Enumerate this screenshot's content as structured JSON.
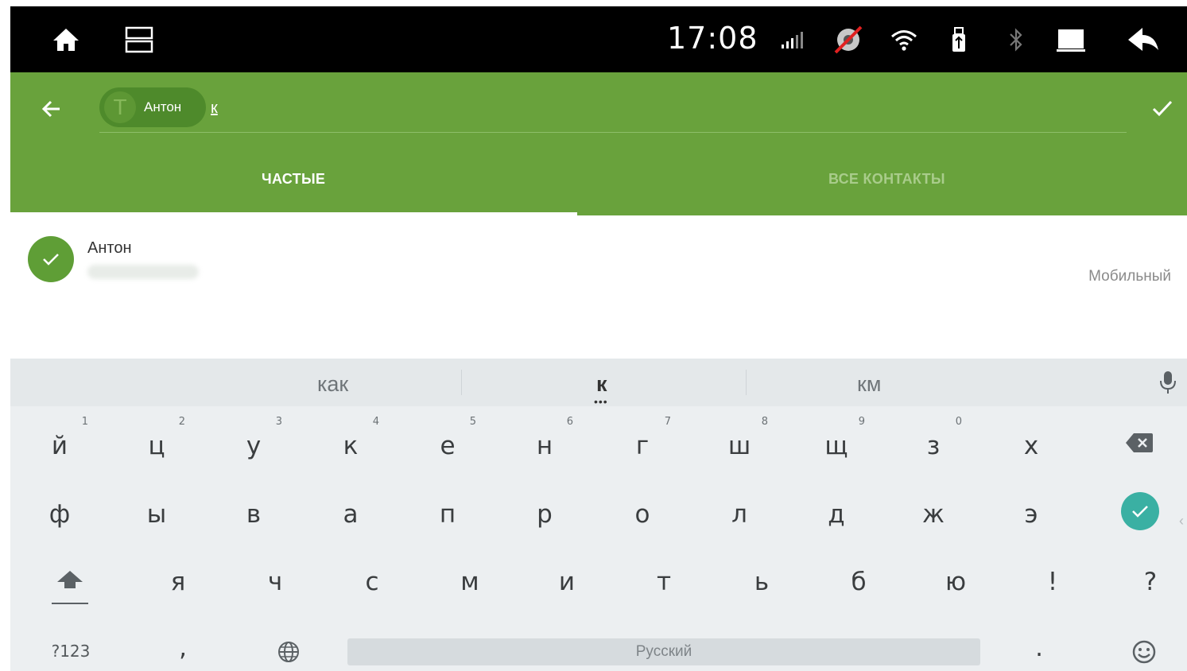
{
  "status_bar": {
    "time": "17:08",
    "icons": [
      "home-icon",
      "recent-apps-icon",
      "signal-icon",
      "gps-off-icon",
      "wifi-icon",
      "usb-icon",
      "bluetooth-icon",
      "screen-icon",
      "back-icon"
    ]
  },
  "header": {
    "chip": {
      "avatar_letter": "T",
      "name": "Антон"
    },
    "query": "к",
    "tabs": [
      {
        "label": "ЧАСТЫЕ",
        "active": true
      },
      {
        "label": "ВСЕ КОНТАКТЫ",
        "active": false
      }
    ],
    "colors": {
      "background": "#69a23c",
      "chip": "#4e8a2b"
    }
  },
  "contact": {
    "name": "Антон",
    "type": "Мобильный",
    "selected": true
  },
  "keyboard": {
    "suggestions": [
      "как",
      "к",
      "км"
    ],
    "row1": [
      {
        "label": "й",
        "hint": "1"
      },
      {
        "label": "ц",
        "hint": "2"
      },
      {
        "label": "у",
        "hint": "3"
      },
      {
        "label": "к",
        "hint": "4"
      },
      {
        "label": "е",
        "hint": "5"
      },
      {
        "label": "н",
        "hint": "6"
      },
      {
        "label": "г",
        "hint": "7"
      },
      {
        "label": "ш",
        "hint": "8"
      },
      {
        "label": "щ",
        "hint": "9"
      },
      {
        "label": "з",
        "hint": "0"
      },
      {
        "label": "х",
        "hint": ""
      }
    ],
    "row2": [
      "ф",
      "ы",
      "в",
      "а",
      "п",
      "р",
      "о",
      "л",
      "д",
      "ж",
      "э"
    ],
    "row3": [
      "я",
      "ч",
      "с",
      "м",
      "и",
      "т",
      "ь",
      "б",
      "ю",
      "!",
      "?"
    ],
    "num_key": "?123",
    "comma_key": ",",
    "space_label": "Русский",
    "period_key": ".",
    "enter_color": "#3ab0a3"
  }
}
